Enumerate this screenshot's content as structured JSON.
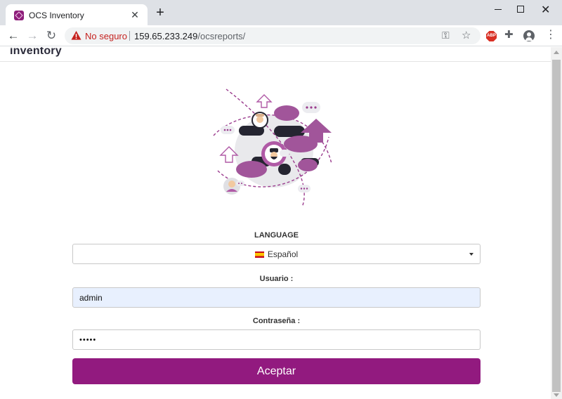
{
  "browser": {
    "tab_title": "OCS Inventory",
    "tab_close": "✕",
    "new_tab": "+",
    "not_secure": "No seguro",
    "url_host": "159.65.233.249",
    "url_path": "/ocsreports/",
    "abp_label": "ABP"
  },
  "page": {
    "brand": "inventory",
    "language_label": "LANGUAGE",
    "language_value": "Español",
    "user_label": "Usuario :",
    "user_value": "admin",
    "password_label": "Contraseña :",
    "password_value": "•••••",
    "submit_label": "Aceptar"
  },
  "colors": {
    "accent": "#921a7f",
    "autofill": "#e8f0fe",
    "not_secure": "#c5221f"
  }
}
